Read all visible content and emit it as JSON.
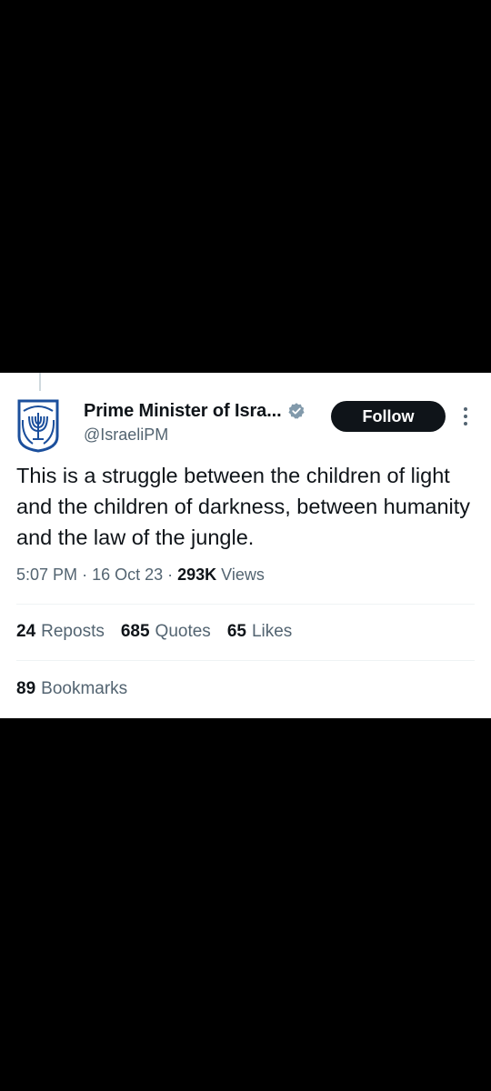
{
  "author": {
    "display_name": "Prime Minister of Isra...",
    "handle": "@IsraeliPM",
    "avatar_icon": "israel-emblem-icon",
    "verified_icon": "verified-badge-icon",
    "verified_color": "#829aab"
  },
  "follow_label": "Follow",
  "more_icon": "more-options-icon",
  "tweet": {
    "text": "This is a struggle between the children of light and the children of darkness, between humanity and the law of the jungle.",
    "time": "5:07 PM",
    "date": "16 Oct 23",
    "views_count": "293K",
    "views_label": "Views"
  },
  "stats": [
    {
      "count": "24",
      "label": "Reposts"
    },
    {
      "count": "685",
      "label": "Quotes"
    },
    {
      "count": "65",
      "label": "Likes"
    }
  ],
  "bookmarks": {
    "count": "89",
    "label": "Bookmarks"
  },
  "colors": {
    "background": "#000000",
    "card": "#ffffff",
    "text": "#0f1419",
    "secondary": "#536471",
    "follow_bg": "#0f1419",
    "emblem": "#1b4f9c"
  }
}
